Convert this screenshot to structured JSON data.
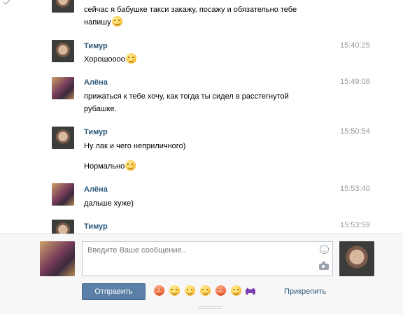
{
  "messages": [
    {
      "id": "m0",
      "author": "",
      "avatar": "timur",
      "time": "",
      "lines": [
        "сейчас я бабушке такси закажу, посажу и обязательно тебе",
        "напишу"
      ],
      "emoji": [
        "smile"
      ]
    },
    {
      "id": "m1",
      "author": "Тимур",
      "avatar": "timur",
      "time": "15:40:25",
      "lines": [
        "Хорошоооо"
      ],
      "emoji": [
        "content"
      ]
    },
    {
      "id": "m2",
      "author": "Алёна",
      "avatar": "alena",
      "time": "15:49:08",
      "lines": [
        "прижаться к тебе хочу, как тогда ты сидел в расстегнутой",
        "рубашке."
      ]
    },
    {
      "id": "m3",
      "author": "Тимур",
      "avatar": "timur",
      "time": "15:50:54",
      "lines": [
        "Ну лак и чего неприличного)",
        "Нормально"
      ],
      "emoji": [
        "grin"
      ]
    },
    {
      "id": "m4",
      "author": "Алёна",
      "avatar": "alena",
      "time": "15:53:40",
      "lines": [
        "дальше хуже)"
      ]
    },
    {
      "id": "m5",
      "author": "Тимур",
      "avatar": "timur",
      "time": "15:53:59",
      "lines": []
    }
  ],
  "composer": {
    "placeholder": "Введите Ваше сообщение..",
    "send_label": "Отправить",
    "attach_label": "Прикрепить",
    "quick_emoji": [
      "surprised-icon",
      "smile-icon",
      "neutral-icon",
      "cold-sweat-icon",
      "angry-icon",
      "kiss-icon",
      "space-invader-icon"
    ]
  },
  "colors": {
    "name": "#2b587a",
    "time": "#999999",
    "button": "#5b7fa6",
    "composer_bg": "#f7f7f7"
  }
}
